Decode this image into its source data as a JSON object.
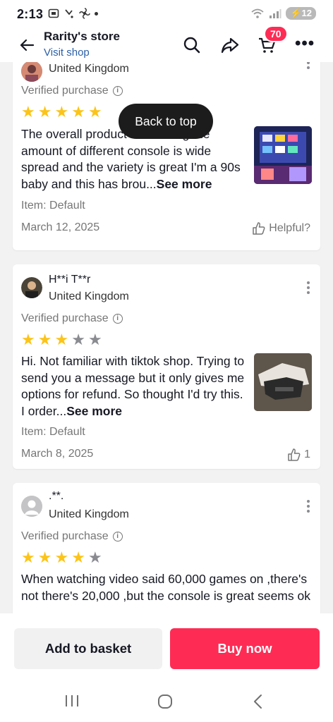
{
  "status_bar": {
    "time": "2:13",
    "battery": "12"
  },
  "header": {
    "store_name": "Rarity's store",
    "visit_shop": "Visit shop",
    "cart_count": "70"
  },
  "back_to_top": "Back to top",
  "reviews": [
    {
      "user": "ˇ ʼ",
      "country": "United Kingdom",
      "verified": "Verified purchase",
      "rating": 5,
      "text": "The overall product is amazing the amount of different console is wide spread and the variety is great I'm a 90s baby and this has brou...",
      "see_more": "See more",
      "item": "Item: Default",
      "date": "March 12, 2025",
      "helpful": "Helpful?"
    },
    {
      "user": "H**i T**r",
      "country": "United Kingdom",
      "verified": "Verified purchase",
      "rating": 3,
      "text": "Hi. Not familiar with tiktok shop. Trying to send you a message but it only gives me options for refund. So thought I'd try this. I order...",
      "see_more": "See more",
      "item": "Item: Default",
      "date": "March 8, 2025",
      "helpful": "1"
    },
    {
      "user": ".**.",
      "country": "United Kingdom",
      "verified": "Verified purchase",
      "rating": 4,
      "text": "When watching video said 60,000 games on ,there's not there's 20,000 ,but the console is great seems ok"
    }
  ],
  "actions": {
    "add_to_basket": "Add to basket",
    "buy_now": "Buy now"
  },
  "colors": {
    "accent": "#fe2c55",
    "star_filled": "#fcc419",
    "star_empty": "#8a8b91",
    "link": "#2b5fa6"
  }
}
